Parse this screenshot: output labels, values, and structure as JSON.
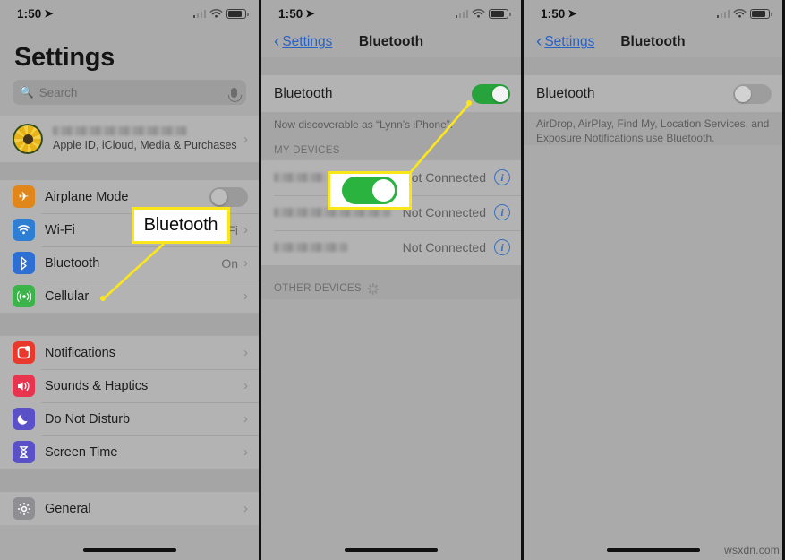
{
  "meta": {
    "watermark": "wsxdn.com"
  },
  "status_bar": {
    "time": "1:50",
    "location_arrow": "location-arrow-icon",
    "wifi": "wifi-icon",
    "battery": "battery-icon",
    "signal": "cellular-bars-icon"
  },
  "panel1": {
    "title": "Settings",
    "search": {
      "placeholder": "Search",
      "icon": "search-icon",
      "mic_icon": "microphone-icon"
    },
    "account": {
      "name_redacted": "",
      "subtitle": "Apple ID, iCloud, Media & Purchases"
    },
    "group1": [
      {
        "label": "Airplane Mode",
        "icon": "airplane-icon",
        "color": "#e0861a",
        "control": "toggle",
        "state": "off"
      },
      {
        "label": "Wi-Fi",
        "icon": "wifi-icon",
        "color": "#2e7fd4",
        "value": "McWiFi",
        "control": "chevron"
      },
      {
        "label": "Bluetooth",
        "icon": "bluetooth-icon",
        "color": "#2e6fd4",
        "value": "On",
        "control": "chevron"
      },
      {
        "label": "Cellular",
        "icon": "cellular-icon",
        "color": "#3cb44a",
        "value": "",
        "control": "chevron"
      }
    ],
    "group2": [
      {
        "label": "Notifications",
        "icon": "notifications-icon",
        "color": "#e8392c",
        "control": "chevron"
      },
      {
        "label": "Sounds & Haptics",
        "icon": "sounds-icon",
        "color": "#e8344f",
        "control": "chevron"
      },
      {
        "label": "Do Not Disturb",
        "icon": "moon-icon",
        "color": "#5a50c8",
        "control": "chevron"
      },
      {
        "label": "Screen Time",
        "icon": "hourglass-icon",
        "color": "#5a50c8",
        "control": "chevron"
      }
    ],
    "group3": [
      {
        "label": "General",
        "icon": "gear-icon",
        "color": "#8e8e93",
        "control": "chevron"
      }
    ]
  },
  "panel2": {
    "nav": {
      "back_label": "Settings",
      "back_icon": "chevron-left-icon",
      "title": "Bluetooth"
    },
    "bluetooth_row": {
      "label": "Bluetooth",
      "state": "on"
    },
    "discoverable_note": "Now discoverable as “Lynn’s iPhone”.",
    "my_devices_header": "MY DEVICES",
    "devices": [
      {
        "name_redacted": "",
        "status": "Not Connected",
        "info_icon": "info-circle-icon"
      },
      {
        "name_redacted": "",
        "status": "Not Connected",
        "info_icon": "info-circle-icon"
      },
      {
        "name_redacted": "",
        "status": "Not Connected",
        "info_icon": "info-circle-icon"
      }
    ],
    "other_devices_header": "OTHER DEVICES",
    "other_devices_spinner": "loading-spinner-icon"
  },
  "panel3": {
    "nav": {
      "back_label": "Settings",
      "back_icon": "chevron-left-icon",
      "title": "Bluetooth"
    },
    "bluetooth_row": {
      "label": "Bluetooth",
      "state": "off"
    },
    "note": "AirDrop, AirPlay, Find My, Location Services, and Exposure Notifications use Bluetooth."
  },
  "annotations": {
    "callout1_text": "Bluetooth",
    "callout2_icon": "bluetooth-toggle-on",
    "accent_color": "#fbe719"
  }
}
